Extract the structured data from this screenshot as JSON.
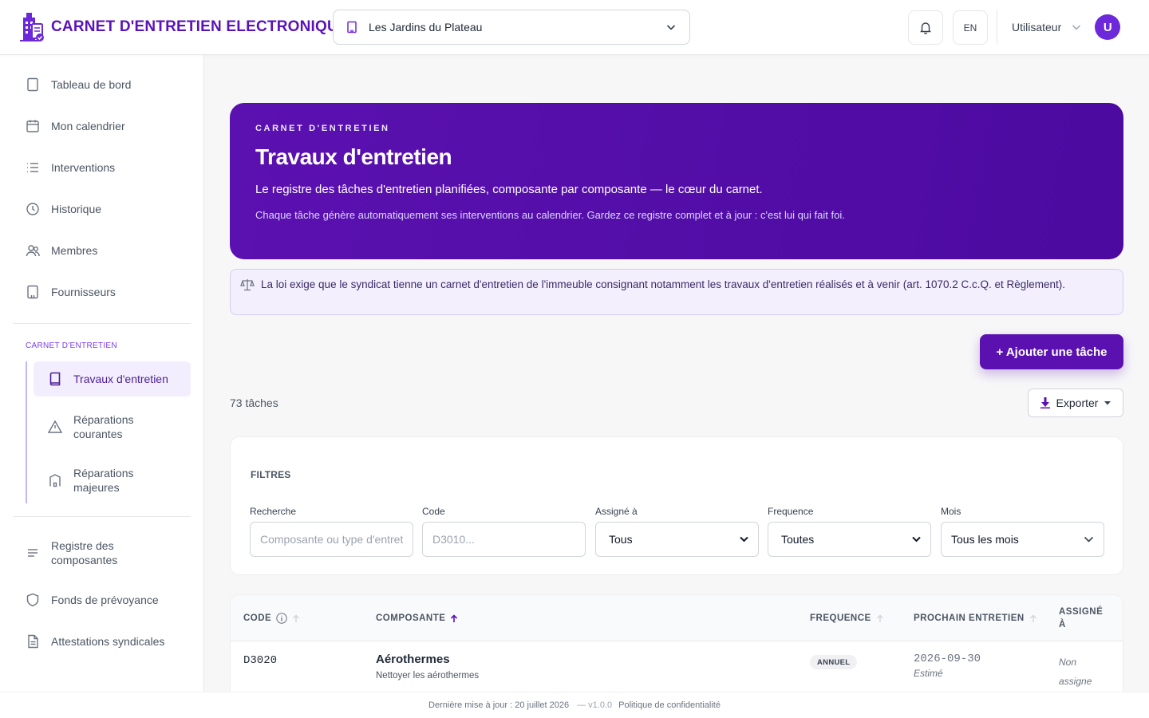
{
  "header": {
    "app_title": "CARNET D'ENTRETIEN ELECTRONIQUE",
    "building": "Les Jardins du Plateau",
    "lang": "EN",
    "user_name": "Utilisateur",
    "avatar_initial": "U",
    "brand_color": "#5b11b0"
  },
  "sidebar": {
    "items": [
      {
        "label": "Tableau de bord",
        "icon": "building-icon"
      },
      {
        "label": "Mon calendrier",
        "icon": "calendar-icon"
      },
      {
        "label": "Interventions",
        "icon": "list-icon"
      },
      {
        "label": "Historique",
        "icon": "clock-icon"
      },
      {
        "label": "Membres",
        "icon": "users-icon"
      },
      {
        "label": "Fournisseurs",
        "icon": "building-icon"
      }
    ],
    "section_label": "CARNET D'ENTRETIEN",
    "sub_items": [
      {
        "label": "Travaux d'entretien",
        "icon": "book-icon",
        "active": true
      },
      {
        "label": "Réparations courantes",
        "icon": "warning-icon"
      },
      {
        "label": "Réparations majeures",
        "icon": "building-icon"
      }
    ],
    "bottom_items": [
      {
        "label": "Registre des composantes",
        "icon": "lines-icon"
      },
      {
        "label": "Fonds de prévoyance",
        "icon": "shield-icon"
      },
      {
        "label": "Attestations syndicales",
        "icon": "document-icon"
      }
    ]
  },
  "hero": {
    "eyebrow": "CARNET D'ENTRETIEN",
    "title": "Travaux d'entretien",
    "lead": "Le registre des tâches d'entretien planifiées, composante par composante — le cœur du carnet.",
    "desc": "Chaque tâche génère automatiquement ses interventions au calendrier. Gardez ce registre complet et à jour : c'est lui qui fait foi."
  },
  "law_notice": "La loi exige que le syndicat tienne un carnet d'entretien de l'immeuble consignant notamment les travaux d'entretien réalisés et à venir (art. 1070.2 C.c.Q. et Règlement).",
  "actions": {
    "add_task": "+ Ajouter une tâche",
    "export": "Exporter"
  },
  "task_count": "73 tâches",
  "filters": {
    "title": "FILTRES",
    "search_label": "Recherche",
    "search_placeholder": "Composante ou type d'entretien",
    "code_label": "Code",
    "code_placeholder": "D3010...",
    "assigned_label": "Assigné à",
    "assigned_value": "Tous",
    "frequency_label": "Frequence",
    "frequency_value": "Toutes",
    "month_label": "Mois",
    "month_value": "Tous les mois"
  },
  "table": {
    "columns": {
      "code": "CODE",
      "component": "COMPOSANTE",
      "frequency": "FREQUENCE",
      "next": "PROCHAIN ENTRETIEN",
      "assigned": "ASSIGNÉ À"
    },
    "rows": [
      {
        "code": "D3020",
        "component": "Aérothermes",
        "task": "Nettoyer les aérothermes",
        "frequency": "ANNUEL",
        "next_date": "2026-09-30",
        "date_status": "Estimé",
        "assigned": "Non assigne"
      }
    ]
  },
  "footer": {
    "updated": "Dernière mise à jour : 20 juillet 2026",
    "version": "— v1.0.0",
    "privacy": "Politique de confidentialité"
  }
}
